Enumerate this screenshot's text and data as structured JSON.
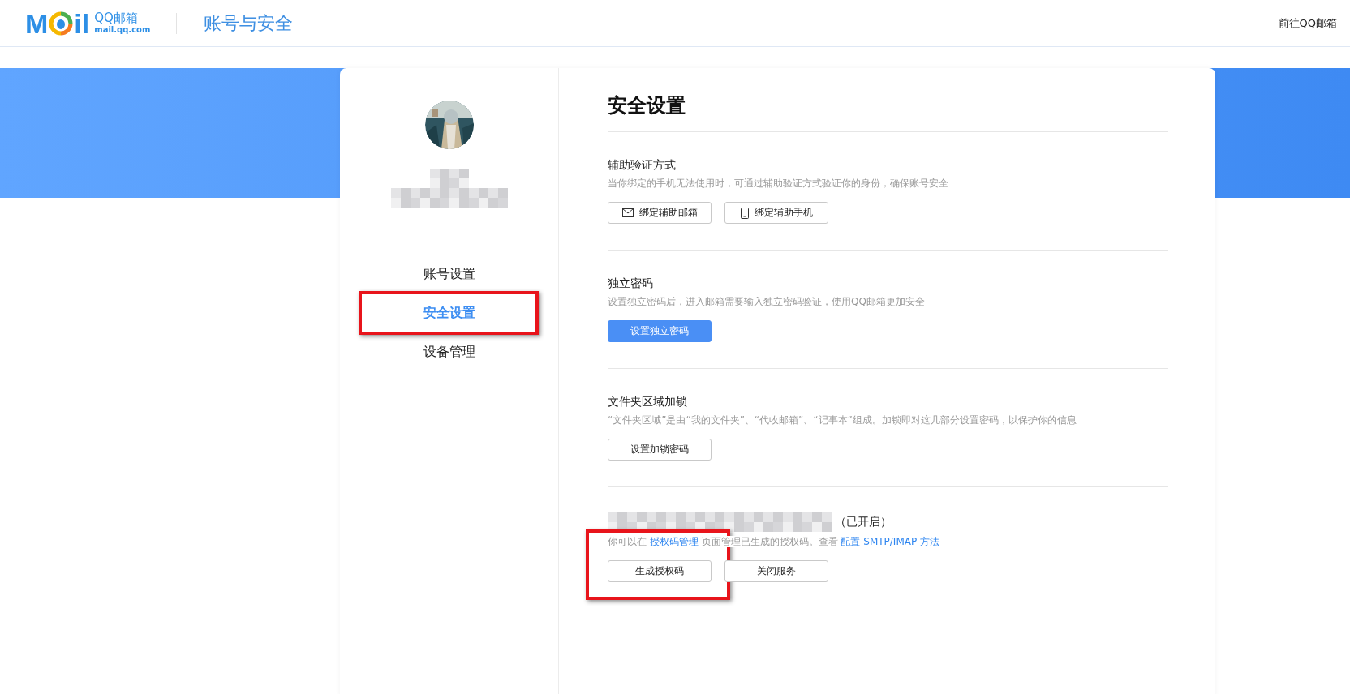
{
  "header": {
    "logo": {
      "left": "M",
      "right": "il",
      "name": "QQ邮箱",
      "domain": "mail.qq.com"
    },
    "title": "账号与安全",
    "link": "前往QQ邮箱"
  },
  "sidebar": {
    "items": [
      {
        "label": "账号设置",
        "selected": false,
        "highlighted": false
      },
      {
        "label": "安全设置",
        "selected": true,
        "highlighted": true
      },
      {
        "label": "设备管理",
        "selected": false,
        "highlighted": false
      }
    ]
  },
  "content": {
    "title": "安全设置",
    "sections": [
      {
        "heading": "辅助验证方式",
        "description": [
          {
            "kind": "text",
            "text": "当你绑定的手机无法使用时，可通过辅助验证方式验证你的身份，确保账号安全"
          }
        ],
        "buttons": [
          {
            "label": "绑定辅助邮箱",
            "kind": "mail",
            "highlighted": false
          },
          {
            "label": "绑定辅助手机",
            "kind": "phone",
            "highlighted": false
          }
        ]
      },
      {
        "heading": "独立密码",
        "description": [
          {
            "kind": "text",
            "text": "设置独立密码后，进入邮箱需要输入独立密码验证，使用QQ邮箱更加安全"
          }
        ],
        "buttons": [
          {
            "label": "设置独立密码",
            "kind": "primary",
            "highlighted": false
          }
        ]
      },
      {
        "heading": "文件夹区域加锁",
        "description": [
          {
            "kind": "text",
            "text": "“文件夹区域”是由“我的文件夹”、“代收邮箱”、“记事本”组成。加锁即对这几部分设置密码，以保护你的信息"
          }
        ],
        "buttons": [
          {
            "label": "设置加锁密码",
            "kind": "outline",
            "highlighted": false
          }
        ]
      },
      {
        "heading_redacted": true,
        "status": "（已开启）",
        "description": [
          {
            "kind": "text",
            "text": "你可以在 "
          },
          {
            "kind": "link",
            "text": "授权码管理"
          },
          {
            "kind": "text",
            "text": " 页面管理已生成的授权码。查看 "
          },
          {
            "kind": "link",
            "text": "配置 SMTP/IMAP 方法"
          }
        ],
        "buttons": [
          {
            "label": "生成授权码",
            "kind": "outline",
            "highlighted": true
          },
          {
            "label": "关闭服务",
            "kind": "outline",
            "highlighted": false
          }
        ]
      }
    ]
  }
}
